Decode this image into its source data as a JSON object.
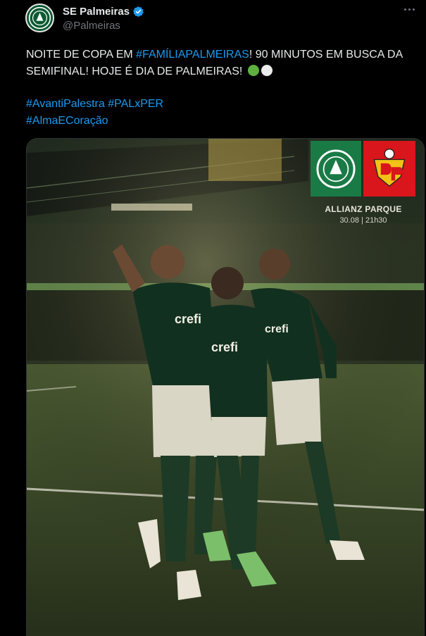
{
  "tweet": {
    "author": {
      "display_name": "SE Palmeiras",
      "handle": "@Palmeiras",
      "verified": true,
      "avatar_icon": "palmeiras-crest-icon"
    },
    "text_line1_a": "NOITE DE COPA EM ",
    "text_line1_hashtag": "#FAMÍLIAPALMEIRAS",
    "text_line1_b": "! 90 MINUTOS EM BUSCA DA",
    "text_line2": "SEMIFINAL! HOJE É DIA DE PALMEIRAS!",
    "hashtags_line1": [
      "#AvantiPalestra",
      "#PALxPER"
    ],
    "hashtags_line2": [
      "#AlmaECoração"
    ],
    "link_color": "#1d9bf0"
  },
  "media": {
    "poster": {
      "venue": "ALLIANZ PARQUE",
      "date": "30.08",
      "time": "21h30",
      "home_badge_color": "#1a7a46",
      "away_badge_color": "#d8161b"
    }
  }
}
